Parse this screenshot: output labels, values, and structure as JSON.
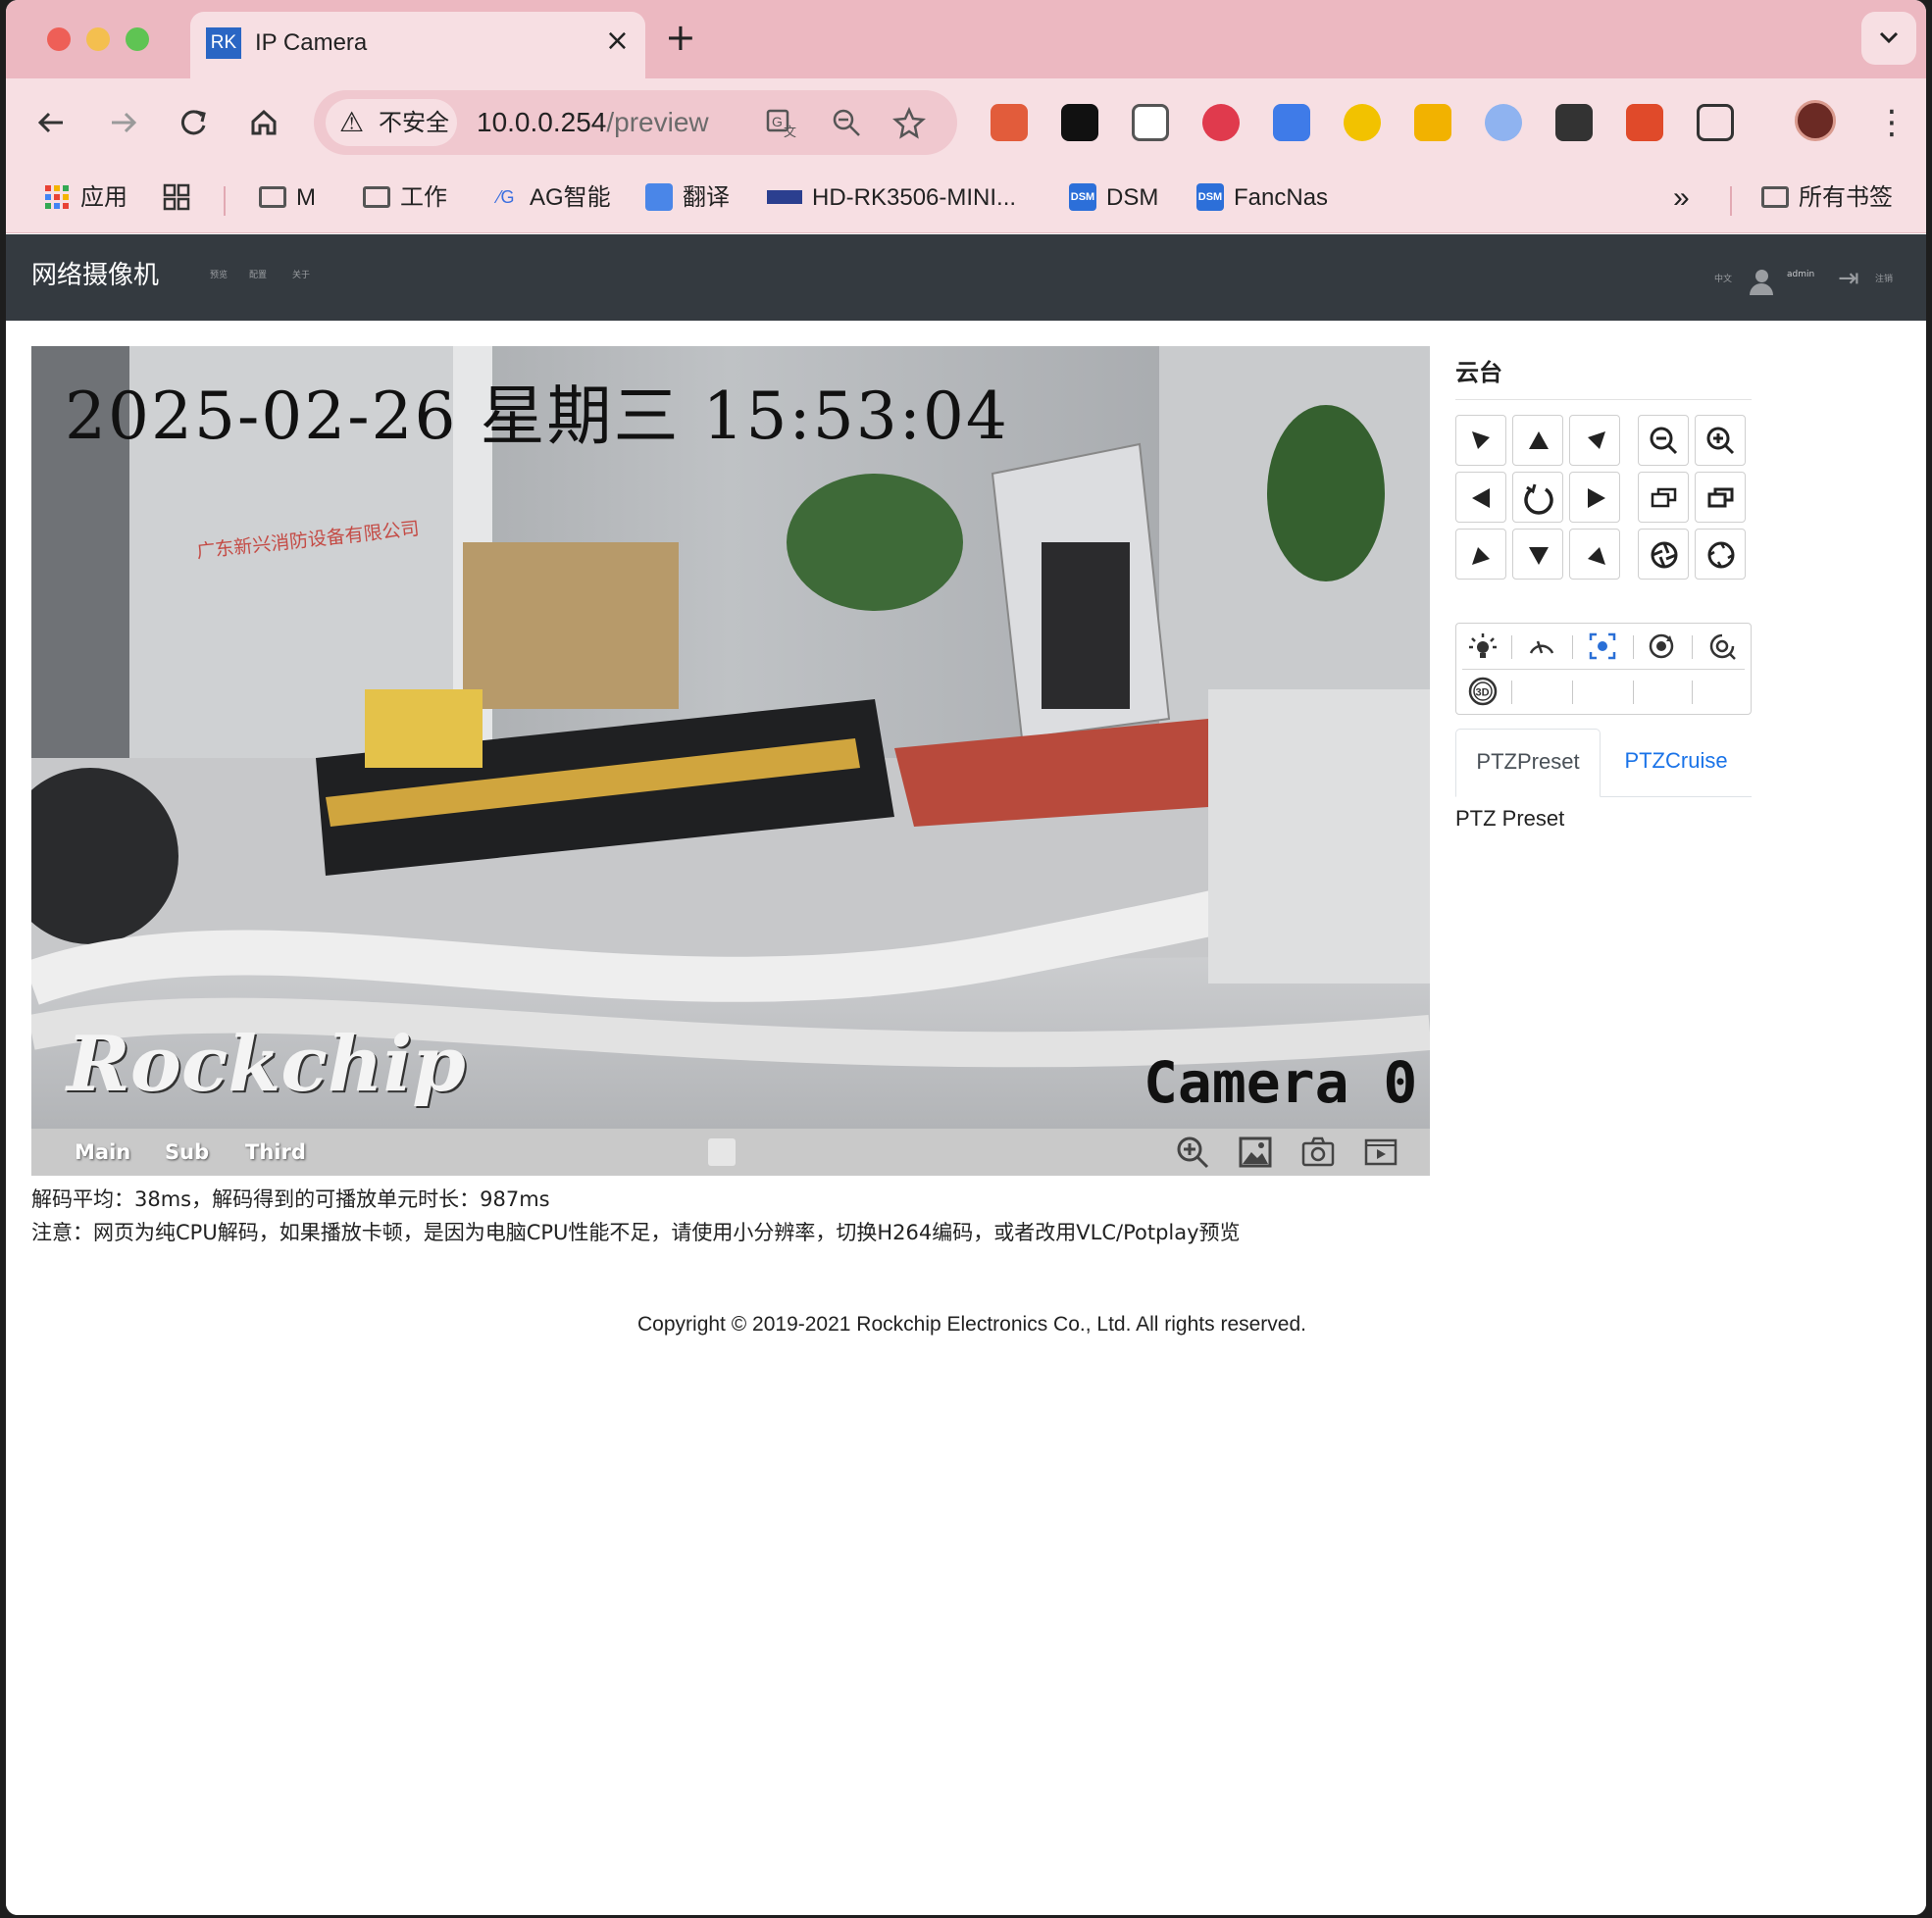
{
  "browser": {
    "tab_title": "IP Camera",
    "tab_favicon_text": "RK",
    "tab_close": "×",
    "new_tab": "+",
    "tab_menu": "⌄",
    "security_label": "不安全",
    "url_host": "10.0.0.254",
    "url_path": "/preview",
    "bookmarks": [
      {
        "label": "应用"
      },
      {
        "label": "M"
      },
      {
        "label": "工作"
      },
      {
        "label": "AG智能"
      },
      {
        "label": "翻译"
      },
      {
        "label": "HD-RK3506-MINI..."
      },
      {
        "label": "DSM"
      },
      {
        "label": "FancNas"
      },
      {
        "label": "»"
      },
      {
        "label": "所有书签"
      }
    ],
    "colors": {
      "tabbar": "#ecb8c1",
      "toolbar": "#f7dfe3"
    }
  },
  "app": {
    "brand": "网络摄像机",
    "nav": {
      "preview": "预览",
      "config": "配置",
      "about": "关于"
    },
    "lang": "中文",
    "user": "admin",
    "logout": "注销",
    "navbar_color": "#343a40"
  },
  "video": {
    "osd_time": "2025-02-26 星期三 15:53:04",
    "osd_logo": "Rockchip",
    "osd_camera": "Camera 0",
    "osd_company": "广东新兴消防设备有限公司",
    "streams": {
      "main": "Main",
      "sub": "Sub",
      "third": "Third"
    },
    "toolbar_icons": [
      "zoom-in-icon",
      "image-icon",
      "camera-icon",
      "record-icon"
    ]
  },
  "stats": {
    "decode_info": "解码平均：38ms，解码得到的可播放单元时长：987ms",
    "note": "注意：网页为纯CPU解码，如果播放卡顿，是因为电脑CPU性能不足，请使用小分辨率，切换H264编码，或者改用VLC/Potplay预览"
  },
  "ptz": {
    "title": "云台",
    "direction_icons": [
      "up-left-arrow",
      "up-arrow",
      "up-right-arrow",
      "left-arrow",
      "auto-scan-icon",
      "right-arrow",
      "down-left-arrow",
      "down-arrow",
      "down-right-arrow"
    ],
    "lens_icons": [
      "zoom-out-icon",
      "zoom-in-icon",
      "focus-near-icon",
      "focus-far-icon",
      "iris-open-icon",
      "iris-close-icon"
    ],
    "function_icons": [
      "light-icon",
      "wiper-icon",
      "focus-frame-icon",
      "refresh-icon",
      "rotate-icon",
      "3d-icon"
    ],
    "function_3d_label": "3D",
    "tabs": {
      "preset": "PTZPreset",
      "cruise": "PTZCruise"
    },
    "preset_label": "PTZ Preset"
  },
  "footer": {
    "copyright": "Copyright © 2019-2021 Rockchip Electronics Co., Ltd. All rights reserved."
  }
}
